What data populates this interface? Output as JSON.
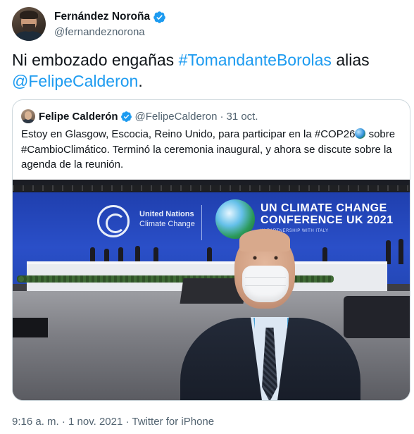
{
  "tweet": {
    "author": {
      "display_name": "Fernández Noroña",
      "handle": "@fernandeznorona",
      "verified_icon": "verified-badge-icon",
      "avatar_icon": "avatar"
    },
    "text": {
      "intro": "Ni embozado engañas ",
      "hashtag": "#TomandanteBorolas",
      "middle": " alias",
      "mention": "@FelipeCalderon",
      "end": "."
    },
    "quoted": {
      "display_name": "Felipe Calderón",
      "handle": "@FelipeCalderon",
      "separator": "·",
      "date": "31 oct.",
      "text_before": "Estoy en Glasgow, Escocia, Reino Unido, para participar en la #COP26",
      "emoji_icon": "globe-emoji-icon",
      "text_after": " sobre #CambioClimático. Terminó la ceremonia inaugural, y ahora se discute sobre la agenda de la reunión.",
      "photo": {
        "un_line1": "United Nations",
        "un_line2": "Climate Change",
        "cop_line1": "UN CLIMATE CHANGE",
        "cop_line2": "CONFERENCE UK 2021",
        "cop_sub": "IN PARTNERSHIP WITH ITALY"
      }
    },
    "footer": "9:16 a. m. · 1 nov. 2021 · Twitter for iPhone"
  },
  "colors": {
    "link": "#1d9bf0",
    "secondary_text": "#536471",
    "border": "#cfd9de",
    "verified": "#1d9bf0"
  }
}
